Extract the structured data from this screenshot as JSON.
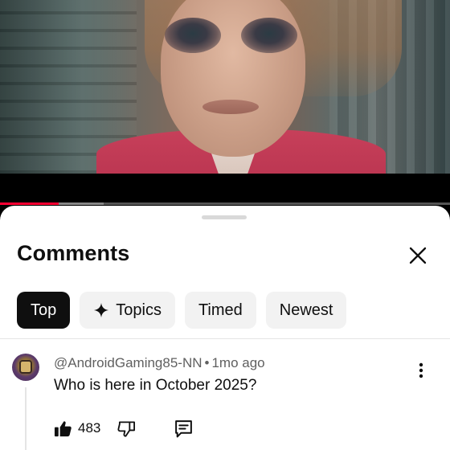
{
  "video": {
    "progress": 0.13,
    "buffered": 0.23
  },
  "comments_panel": {
    "title": "Comments",
    "close_icon": "close-icon",
    "sort_chips": [
      {
        "label": "Top",
        "active": true,
        "icon": null
      },
      {
        "label": "Topics",
        "active": false,
        "icon": "sparkle-icon"
      },
      {
        "label": "Timed",
        "active": false,
        "icon": null
      },
      {
        "label": "Newest",
        "active": false,
        "icon": null
      }
    ]
  },
  "comment": {
    "author": "@AndroidGaming85-NN",
    "separator": "•",
    "time": "1mo ago",
    "text": "Who is here in October 2025?",
    "likes": "483",
    "icons": [
      "thumbs-up-icon",
      "thumbs-down-icon",
      "reply-icon",
      "more-vert-icon"
    ]
  },
  "colors": {
    "progress": "#ff0033",
    "active_chip": "#0f0f0f",
    "chip": "#f2f2f2",
    "meta_text": "#606060"
  }
}
